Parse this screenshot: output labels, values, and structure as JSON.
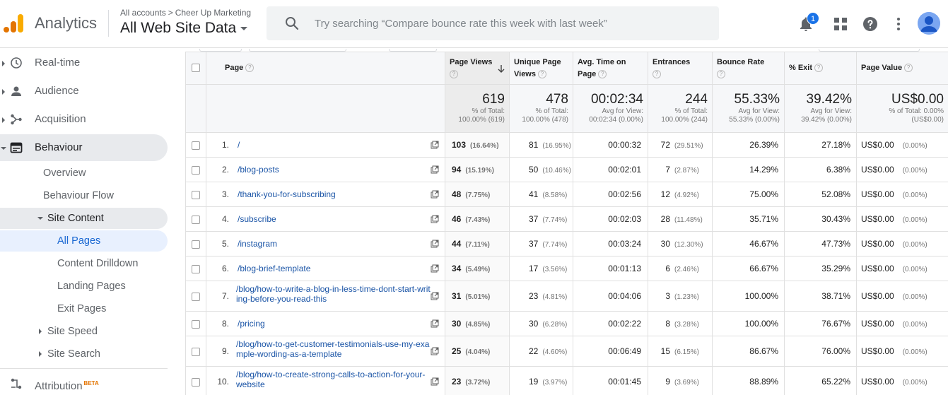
{
  "app": {
    "product": "Analytics",
    "breadcrumb": {
      "account": "All accounts",
      "separator": ">",
      "property": "Cheer Up Marketing"
    },
    "view": "All Web Site Data",
    "search_placeholder": "Try searching “Compare bounce rate this week with last week”",
    "notifications_count": "1",
    "brand_colors": {
      "logo_orange": "#f9ab00",
      "logo_dark": "#e37400",
      "accent": "#1a73e8"
    }
  },
  "sidebar": {
    "items": [
      {
        "label": "Real-time",
        "icon": "clock-icon"
      },
      {
        "label": "Audience",
        "icon": "person-icon"
      },
      {
        "label": "Acquisition",
        "icon": "acquisition-icon"
      },
      {
        "label": "Behaviour",
        "icon": "behaviour-icon"
      }
    ],
    "behaviour_sub": {
      "overview": "Overview",
      "flow": "Behaviour Flow",
      "site_content": "Site Content",
      "all_pages": "All Pages",
      "content_drilldown": "Content Drilldown",
      "landing_pages": "Landing Pages",
      "exit_pages": "Exit Pages",
      "site_speed": "Site Speed",
      "site_search": "Site Search"
    },
    "attribution": {
      "label": "Attribution",
      "badge": "BETA"
    }
  },
  "table": {
    "columns": {
      "page": "Page",
      "pageviews": "Page Views",
      "unique": "Unique Page Views",
      "avgtime": "Avg. Time on Page",
      "entrances": "Entrances",
      "bounce": "Bounce Rate",
      "exit": "% Exit",
      "value": "Page Value"
    },
    "totals": {
      "pageviews": {
        "value": "619",
        "l1": "% of Total:",
        "l2": "100.00% (619)"
      },
      "unique": {
        "value": "478",
        "l1": "% of Total:",
        "l2": "100.00% (478)"
      },
      "avgtime": {
        "value": "00:02:34",
        "l1": "Avg for View:",
        "l2": "00:02:34 (0.00%)"
      },
      "entrances": {
        "value": "244",
        "l1": "% of Total:",
        "l2": "100.00% (244)"
      },
      "bounce": {
        "value": "55.33%",
        "l1": "Avg for View:",
        "l2": "55.33% (0.00%)"
      },
      "exit": {
        "value": "39.42%",
        "l1": "Avg for View:",
        "l2": "39.42% (0.00%)"
      },
      "value": {
        "value": "US$0.00",
        "l1": "% of Total: 0.00%",
        "l2": "(US$0.00)"
      }
    },
    "rows": [
      {
        "n": "1.",
        "page": "/",
        "pv": "103",
        "pvp": "(16.64%)",
        "upv": "81",
        "upvp": "(16.95%)",
        "time": "00:00:32",
        "ent": "72",
        "entp": "(29.51%)",
        "bounce": "26.39%",
        "exit": "27.18%",
        "val": "US$0.00",
        "valp": "(0.00%)"
      },
      {
        "n": "2.",
        "page": "/blog-posts",
        "pv": "94",
        "pvp": "(15.19%)",
        "upv": "50",
        "upvp": "(10.46%)",
        "time": "00:02:01",
        "ent": "7",
        "entp": "(2.87%)",
        "bounce": "14.29%",
        "exit": "6.38%",
        "val": "US$0.00",
        "valp": "(0.00%)"
      },
      {
        "n": "3.",
        "page": "/thank-you-for-subscribing",
        "pv": "48",
        "pvp": "(7.75%)",
        "upv": "41",
        "upvp": "(8.58%)",
        "time": "00:02:56",
        "ent": "12",
        "entp": "(4.92%)",
        "bounce": "75.00%",
        "exit": "52.08%",
        "val": "US$0.00",
        "valp": "(0.00%)"
      },
      {
        "n": "4.",
        "page": "/subscribe",
        "pv": "46",
        "pvp": "(7.43%)",
        "upv": "37",
        "upvp": "(7.74%)",
        "time": "00:02:03",
        "ent": "28",
        "entp": "(11.48%)",
        "bounce": "35.71%",
        "exit": "30.43%",
        "val": "US$0.00",
        "valp": "(0.00%)"
      },
      {
        "n": "5.",
        "page": "/instagram",
        "pv": "44",
        "pvp": "(7.11%)",
        "upv": "37",
        "upvp": "(7.74%)",
        "time": "00:03:24",
        "ent": "30",
        "entp": "(12.30%)",
        "bounce": "46.67%",
        "exit": "47.73%",
        "val": "US$0.00",
        "valp": "(0.00%)"
      },
      {
        "n": "6.",
        "page": "/blog-brief-template",
        "pv": "34",
        "pvp": "(5.49%)",
        "upv": "17",
        "upvp": "(3.56%)",
        "time": "00:01:13",
        "ent": "6",
        "entp": "(2.46%)",
        "bounce": "66.67%",
        "exit": "35.29%",
        "val": "US$0.00",
        "valp": "(0.00%)"
      },
      {
        "n": "7.",
        "page": "/blog/how-to-write-a-blog-in-less-time-dont-start-writing-before-you-read-this",
        "pv": "31",
        "pvp": "(5.01%)",
        "upv": "23",
        "upvp": "(4.81%)",
        "time": "00:04:06",
        "ent": "3",
        "entp": "(1.23%)",
        "bounce": "100.00%",
        "exit": "38.71%",
        "val": "US$0.00",
        "valp": "(0.00%)"
      },
      {
        "n": "8.",
        "page": "/pricing",
        "pv": "30",
        "pvp": "(4.85%)",
        "upv": "30",
        "upvp": "(6.28%)",
        "time": "00:02:22",
        "ent": "8",
        "entp": "(3.28%)",
        "bounce": "100.00%",
        "exit": "76.67%",
        "val": "US$0.00",
        "valp": "(0.00%)"
      },
      {
        "n": "9.",
        "page": "/blog/how-to-get-customer-testimonials-use-my-example-wording-as-a-template",
        "pv": "25",
        "pvp": "(4.04%)",
        "upv": "22",
        "upvp": "(4.60%)",
        "time": "00:06:49",
        "ent": "15",
        "entp": "(6.15%)",
        "bounce": "86.67%",
        "exit": "76.00%",
        "val": "US$0.00",
        "valp": "(0.00%)"
      },
      {
        "n": "10.",
        "page": "/blog/how-to-create-strong-calls-to-action-for-your-website",
        "pv": "23",
        "pvp": "(3.72%)",
        "upv": "19",
        "upvp": "(3.97%)",
        "time": "00:01:45",
        "ent": "9",
        "entp": "(3.69%)",
        "bounce": "88.89%",
        "exit": "65.22%",
        "val": "US$0.00",
        "valp": "(0.00%)"
      }
    ]
  }
}
